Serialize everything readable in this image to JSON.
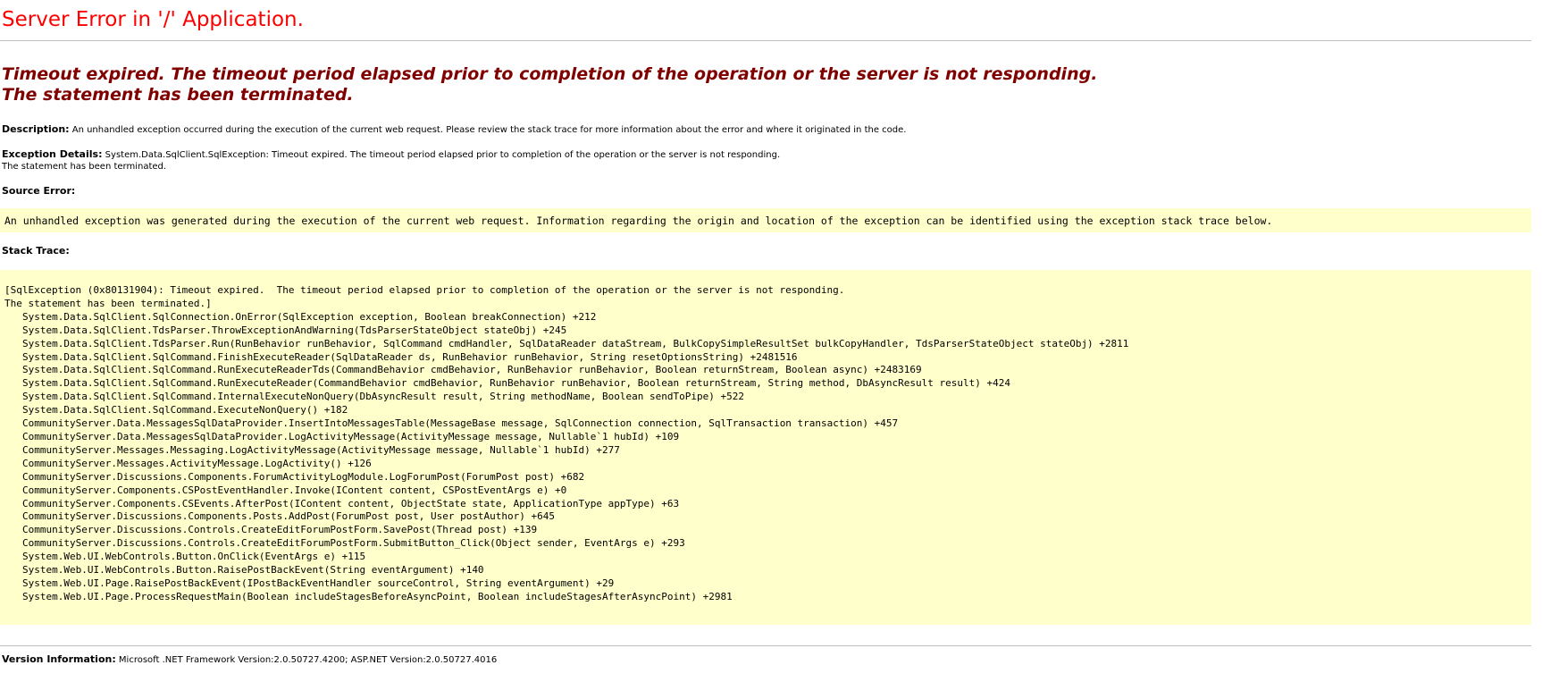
{
  "title": "Server Error in '/' Application.",
  "error_message": {
    "line1": "Timeout expired.  The timeout period elapsed prior to completion of the operation or the server is not responding.",
    "line2": "The statement has been terminated."
  },
  "description": {
    "label": "Description:",
    "text": "An unhandled exception occurred during the execution of the current web request. Please review the stack trace for more information about the error and where it originated in the code."
  },
  "exception_details": {
    "label": "Exception Details:",
    "text": "System.Data.SqlClient.SqlException: Timeout expired.  The timeout period elapsed prior to completion of the operation or the server is not responding.",
    "text2": "The statement has been terminated."
  },
  "source_error": {
    "label": "Source Error:",
    "text": "An unhandled exception was generated during the execution of the current web request. Information regarding the origin and location of the exception can be identified using the exception stack trace below."
  },
  "stack_trace": {
    "label": "Stack Trace:",
    "header1": "[SqlException (0x80131904): Timeout expired.  The timeout period elapsed prior to completion of the operation or the server is not responding.",
    "header2": "The statement has been terminated.]",
    "frames": [
      "System.Data.SqlClient.SqlConnection.OnError(SqlException exception, Boolean breakConnection) +212",
      "System.Data.SqlClient.TdsParser.ThrowExceptionAndWarning(TdsParserStateObject stateObj) +245",
      "System.Data.SqlClient.TdsParser.Run(RunBehavior runBehavior, SqlCommand cmdHandler, SqlDataReader dataStream, BulkCopySimpleResultSet bulkCopyHandler, TdsParserStateObject stateObj) +2811",
      "System.Data.SqlClient.SqlCommand.FinishExecuteReader(SqlDataReader ds, RunBehavior runBehavior, String resetOptionsString) +2481516",
      "System.Data.SqlClient.SqlCommand.RunExecuteReaderTds(CommandBehavior cmdBehavior, RunBehavior runBehavior, Boolean returnStream, Boolean async) +2483169",
      "System.Data.SqlClient.SqlCommand.RunExecuteReader(CommandBehavior cmdBehavior, RunBehavior runBehavior, Boolean returnStream, String method, DbAsyncResult result) +424",
      "System.Data.SqlClient.SqlCommand.InternalExecuteNonQuery(DbAsyncResult result, String methodName, Boolean sendToPipe) +522",
      "System.Data.SqlClient.SqlCommand.ExecuteNonQuery() +182",
      "CommunityServer.Data.MessagesSqlDataProvider.InsertIntoMessagesTable(MessageBase message, SqlConnection connection, SqlTransaction transaction) +457",
      "CommunityServer.Data.MessagesSqlDataProvider.LogActivityMessage(ActivityMessage message, Nullable`1 hubId) +109",
      "CommunityServer.Messages.Messaging.LogActivityMessage(ActivityMessage message, Nullable`1 hubId) +277",
      "CommunityServer.Messages.ActivityMessage.LogActivity() +126",
      "CommunityServer.Discussions.Components.ForumActivityLogModule.LogForumPost(ForumPost post) +682",
      "CommunityServer.Components.CSPostEventHandler.Invoke(IContent content, CSPostEventArgs e) +0",
      "CommunityServer.Components.CSEvents.AfterPost(IContent content, ObjectState state, ApplicationType appType) +63",
      "CommunityServer.Discussions.Components.Posts.AddPost(ForumPost post, User postAuthor) +645",
      "CommunityServer.Discussions.Controls.CreateEditForumPostForm.SavePost(Thread post) +139",
      "CommunityServer.Discussions.Controls.CreateEditForumPostForm.SubmitButton_Click(Object sender, EventArgs e) +293",
      "System.Web.UI.WebControls.Button.OnClick(EventArgs e) +115",
      "System.Web.UI.WebControls.Button.RaisePostBackEvent(String eventArgument) +140",
      "System.Web.UI.Page.RaisePostBackEvent(IPostBackEventHandler sourceControl, String eventArgument) +29",
      "System.Web.UI.Page.ProcessRequestMain(Boolean includeStagesBeforeAsyncPoint, Boolean includeStagesAfterAsyncPoint) +2981"
    ]
  },
  "version_info": {
    "label": "Version Information:",
    "text": "Microsoft .NET Framework Version:2.0.50727.4200; ASP.NET Version:2.0.50727.4016"
  }
}
